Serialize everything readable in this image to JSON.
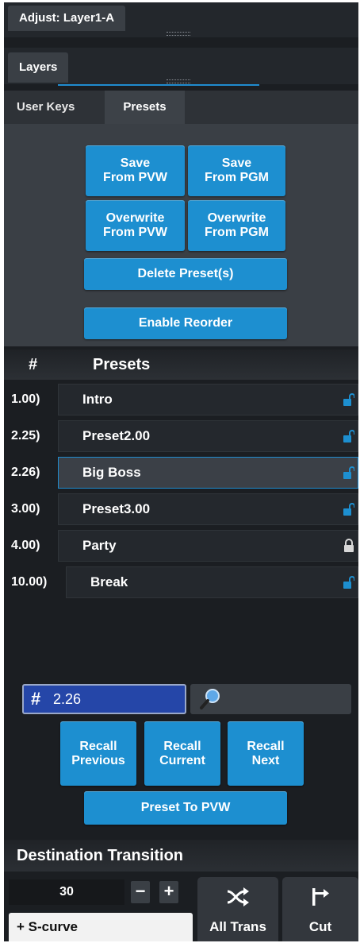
{
  "tabs": {
    "adjust": "Adjust: Layer1-A",
    "layers": "Layers"
  },
  "subtabs": {
    "user_keys": "User Keys",
    "presets": "Presets"
  },
  "buttons": {
    "save_pvw": "Save\nFrom PVW",
    "save_pgm": "Save\nFrom PGM",
    "overwrite_pvw": "Overwrite\nFrom PVW",
    "overwrite_pgm": "Overwrite\nFrom PGM",
    "delete": "Delete Preset(s)",
    "reorder": "Enable Reorder"
  },
  "list": {
    "col_num": "#",
    "col_name": "Presets",
    "rows": [
      {
        "num": "1.00)",
        "name": "Intro",
        "locked": false,
        "selected": false
      },
      {
        "num": "2.25)",
        "name": "Preset2.00",
        "locked": false,
        "selected": false
      },
      {
        "num": "2.26)",
        "name": "Big Boss",
        "locked": false,
        "selected": true
      },
      {
        "num": "3.00)",
        "name": "Preset3.00",
        "locked": false,
        "selected": false
      },
      {
        "num": "4.00)",
        "name": "Party",
        "locked": true,
        "selected": false
      },
      {
        "num": "10.00)",
        "name": "Break",
        "locked": false,
        "selected": false
      }
    ]
  },
  "search": {
    "hash": "#",
    "value": "2.26"
  },
  "recall": {
    "previous": "Recall\nPrevious",
    "current": "Recall\nCurrent",
    "next": "Recall\nNext",
    "preset_to_pvw": "Preset To PVW"
  },
  "transition": {
    "header": "Destination Transition",
    "duration": "30",
    "minus": "−",
    "plus": "+",
    "curve": "+ S-curve",
    "all_trans": "All Trans",
    "cut": "Cut"
  },
  "colors": {
    "accent": "#1d8fd0",
    "selected_border": "#1f8ccf",
    "field_bg": "#2546a8"
  }
}
